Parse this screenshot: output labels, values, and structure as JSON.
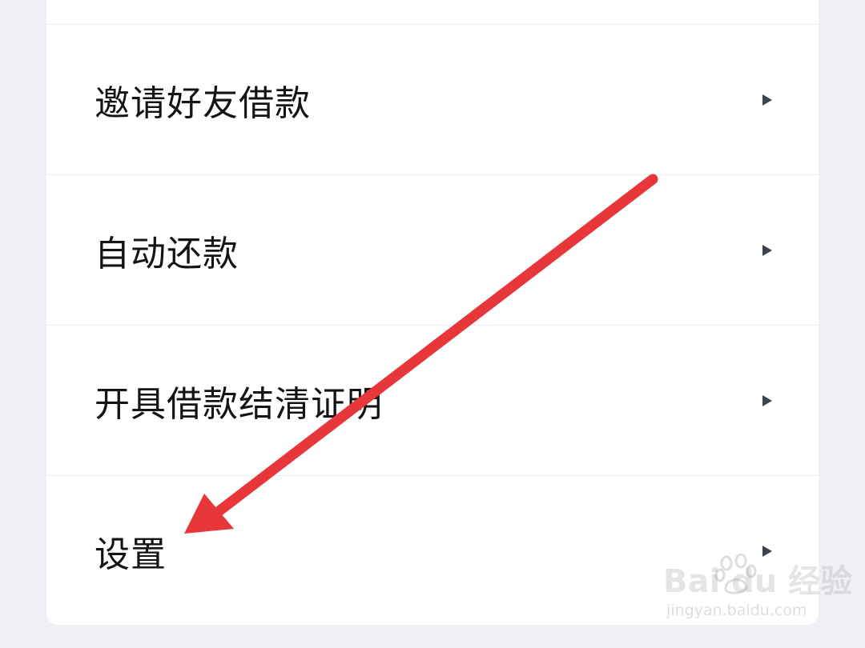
{
  "menu": {
    "items": [
      {
        "label": "邀请好友借款"
      },
      {
        "label": "自动还款"
      },
      {
        "label": "开具借款结清证明"
      },
      {
        "label": "设置"
      }
    ]
  },
  "watermark": {
    "main": "Bai  du 经验",
    "sub": "jingyan.baidu.com"
  },
  "colors": {
    "background": "#eef0f6",
    "card": "#ffffff",
    "text": "#141414",
    "chevron": "#3c4250",
    "arrow": "#e8373a"
  },
  "icons": {
    "chevron": "chevron-right-icon",
    "annotation": "red-arrow-icon"
  }
}
